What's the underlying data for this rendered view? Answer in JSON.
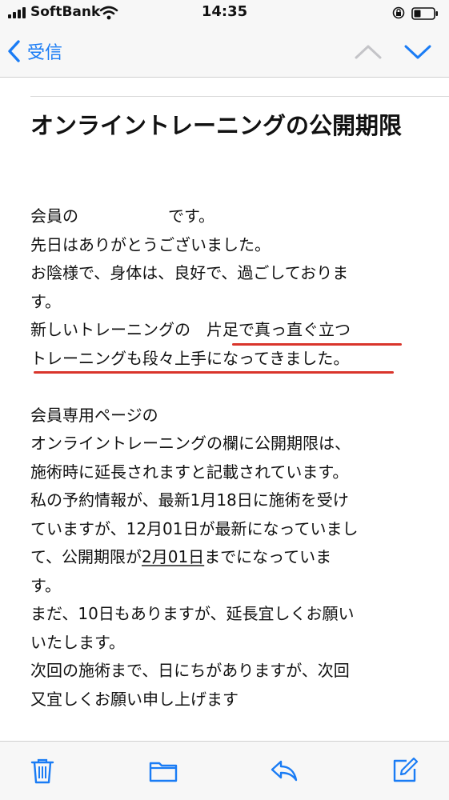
{
  "status_bar": {
    "carrier": "SoftBank",
    "time": "14:35"
  },
  "nav": {
    "back_label": "受信"
  },
  "email": {
    "subject": "オンライントレーニングの公開期限",
    "body": {
      "greeting_prefix": "会員の",
      "greeting_suffix": "です。",
      "line2": "先日はありがとうございました。",
      "line3": "お陰様で、身体は、良好で、過ごしておりま",
      "line4": "す。",
      "line5": "新しいトレーニングの　片足で真っ直ぐ立つ",
      "line6": "トレーニングも段々上手になってきました。",
      "line7": "会員専用ページの",
      "line8": "オンライントレーニングの欄に公開期限は、",
      "line9": "施術時に延長されますと記載されています。",
      "line10": "私の予約情報が、最新1月18日に施術を受け",
      "line11": "ていますが、12月01日が最新になっていまし",
      "line12_prefix": "て、公開期限が",
      "line12_date": "2月01日",
      "line12_suffix": "までになっていま",
      "line13": "す。",
      "line14": "まだ、10日もありますが、延長宜しくお願い",
      "line15": "いたします。",
      "line16": "次回の施術まで、日にちがありますが、次回",
      "line17": "又宜しくお願い申し上げます"
    }
  },
  "colors": {
    "accent": "#1a7cf5",
    "underline": "#d9352b"
  }
}
